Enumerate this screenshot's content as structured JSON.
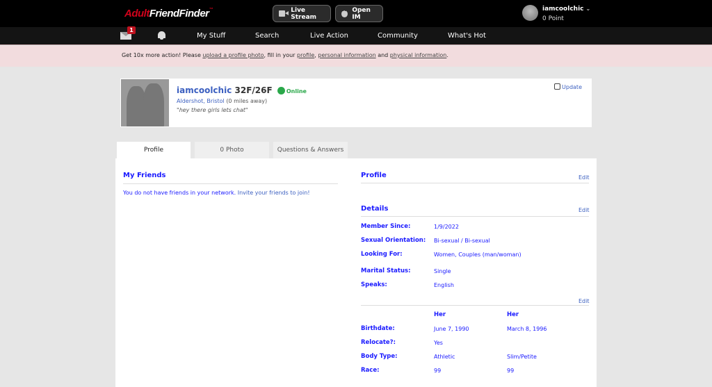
{
  "header": {
    "logo_part1": "Adult",
    "logo_part2": "FriendFinder",
    "logo_tm": "™",
    "live_stream_label": "Live Stream",
    "open_im_label": "Open IM",
    "username": "iamcoolchic",
    "points": "0 Point"
  },
  "nav": {
    "messages_badge": "1",
    "items": [
      "My Stuff",
      "Search",
      "Live Action",
      "Community",
      "What's Hot"
    ]
  },
  "promo": {
    "text1": "Get 10x more action! Please ",
    "link1": "upload a profile photo",
    "text2": ", fill in your ",
    "link2": "profile",
    "text3": ", ",
    "link3": "personal information",
    "text4": " and ",
    "link4": "physical information",
    "text5": "."
  },
  "profile": {
    "username": "iamcoolchic",
    "ages": "32F/26F",
    "status": "Online",
    "city": "Aldershot, Bristol",
    "distance": "(0 miles away)",
    "quote": "hey there girls lets chat",
    "update_label": "Update"
  },
  "tabs": [
    "Profile",
    "0 Photo",
    "Questions & Answers"
  ],
  "friends": {
    "title": "My Friends",
    "empty_text": "You do not have friends in your network.",
    "invite_link": "Invite your friends to join!"
  },
  "profile_section": {
    "title": "Profile",
    "edit": "Edit"
  },
  "details": {
    "title": "Details",
    "edit": "Edit",
    "rows": [
      {
        "label": "Member Since:",
        "value": "1/9/2022"
      },
      {
        "label": "Sexual Orientation:",
        "value": "Bi-sexual / Bi-sexual"
      },
      {
        "label": "Looking For:",
        "value": "Women, Couples (man/woman)"
      },
      {
        "label": "Marital Status:",
        "value": "Single"
      },
      {
        "label": "Speaks:",
        "value": "English"
      }
    ]
  },
  "physical": {
    "edit": "Edit",
    "col_headers": [
      "Her",
      "Her"
    ],
    "rows": [
      {
        "label": "Birthdate:",
        "v1": "June 7, 1990",
        "v2": "March 8, 1996"
      },
      {
        "label": "Relocate?:",
        "v1": "Yes",
        "v2": ""
      },
      {
        "label": "Body Type:",
        "v1": "Athletic",
        "v2": "Slim/Petite"
      },
      {
        "label": "Race:",
        "v1": "99",
        "v2": "99"
      }
    ]
  }
}
